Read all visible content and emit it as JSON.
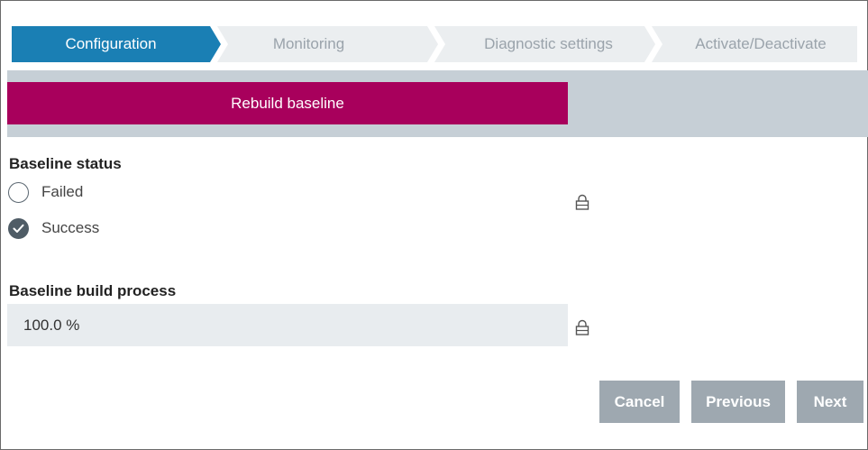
{
  "stepper": {
    "steps": [
      {
        "label": "Configuration",
        "state": "active"
      },
      {
        "label": "Monitoring",
        "state": "inactive"
      },
      {
        "label": "Diagnostic settings",
        "state": "inactive"
      },
      {
        "label": "Activate/Deactivate",
        "state": "inactive"
      }
    ]
  },
  "actions": {
    "rebuild_label": "Rebuild baseline"
  },
  "baseline_status": {
    "title": "Baseline status",
    "options": [
      {
        "label": "Failed",
        "checked": false
      },
      {
        "label": "Success",
        "checked": true
      }
    ],
    "locked_icon": "lock-icon"
  },
  "baseline_build": {
    "title": "Baseline build process",
    "value": "100.0 %",
    "progress_percent": 100.0,
    "locked_icon": "lock-icon"
  },
  "footer": {
    "cancel_label": "Cancel",
    "previous_label": "Previous",
    "next_label": "Next"
  },
  "colors": {
    "active_step": "#1a7fb4",
    "inactive_step": "#ebeef0",
    "primary_action": "#a8005c",
    "band": "#c6cfd6",
    "footer_button": "#9ea8b0"
  }
}
